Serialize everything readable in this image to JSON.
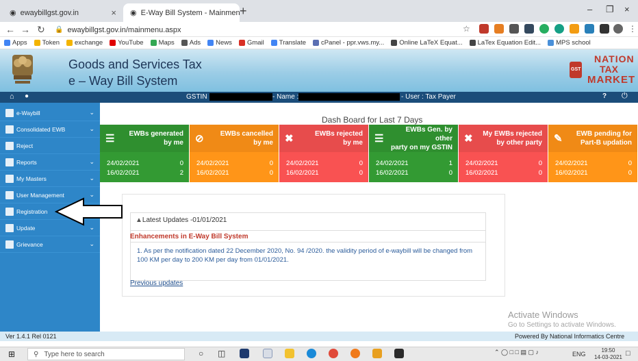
{
  "browser": {
    "tab1_title": "ewaybillgst.gov.in",
    "tab2_title": "E-Way Bill System - Mainmenu",
    "url": "ewaybillgst.gov.in/mainmenu.aspx",
    "bookmarks": [
      {
        "label": "Apps",
        "color": "#4285f4"
      },
      {
        "label": "Token",
        "color": "#f4b400"
      },
      {
        "label": "exchange",
        "color": "#f4b400"
      },
      {
        "label": "YouTube",
        "color": "#e00000"
      },
      {
        "label": "Maps",
        "color": "#34a853"
      },
      {
        "label": "Ads",
        "color": "#555555"
      },
      {
        "label": "News",
        "color": "#4285f4"
      },
      {
        "label": "Gmail",
        "color": "#d93025"
      },
      {
        "label": "Translate",
        "color": "#4285f4"
      },
      {
        "label": "cPanel - ppr.vws.my...",
        "color": "#5b6fb3"
      },
      {
        "label": "Online LaTeX Equat...",
        "color": "#444444"
      },
      {
        "label": "LaTex Equation Edit...",
        "color": "#444444"
      },
      {
        "label": "MPS school",
        "color": "#4a90d9"
      }
    ]
  },
  "header": {
    "title_line1": "Goods and Services Tax",
    "title_line2": "e – Way Bill System",
    "logo_line1": "NATION",
    "logo_line2": "TAX",
    "logo_line3": "MARKET",
    "logo_badge": "GST"
  },
  "gstbar": {
    "gstin_label": "GSTIN :",
    "name_label": "- Name :",
    "user_label": "- User : Tax Payer"
  },
  "sidebar": {
    "items": [
      {
        "label": "e-Waybill",
        "chevron": true
      },
      {
        "label": "Consolidated EWB",
        "chevron": true
      },
      {
        "label": "Reject",
        "chevron": false
      },
      {
        "label": "Reports",
        "chevron": true
      },
      {
        "label": "My Masters",
        "chevron": true
      },
      {
        "label": "User Management",
        "chevron": true
      },
      {
        "label": "Registration",
        "chevron": true
      },
      {
        "label": "Update",
        "chevron": true
      },
      {
        "label": "Grievance",
        "chevron": true
      }
    ]
  },
  "dashboard": {
    "title": "Dash Board for Last 7 Days",
    "cards": [
      {
        "title1": "EWBs generated",
        "title2": "by me",
        "icon": "☰",
        "color": "#2f8f2f",
        "rows": [
          {
            "date": "24/02/2021",
            "count": "0"
          },
          {
            "date": "16/02/2021",
            "count": "2"
          }
        ]
      },
      {
        "title1": "EWBs cancelled",
        "title2": "by me",
        "icon": "⊘",
        "color": "#f08a16",
        "rows": [
          {
            "date": "24/02/2021",
            "count": "0"
          },
          {
            "date": "16/02/2021",
            "count": "0"
          }
        ]
      },
      {
        "title1": "EWBs rejected",
        "title2": "by me",
        "icon": "✖",
        "color": "#e74c4c",
        "rows": [
          {
            "date": "24/02/2021",
            "count": "0"
          },
          {
            "date": "16/02/2021",
            "count": "0"
          }
        ]
      },
      {
        "title1": "EWBs Gen. by other",
        "title2": "party on my GSTIN",
        "icon": "☰",
        "color": "#2f8f2f",
        "rows": [
          {
            "date": "24/02/2021",
            "count": "1"
          },
          {
            "date": "16/02/2021",
            "count": "0"
          }
        ]
      },
      {
        "title1": "My EWBs rejected",
        "title2": "by other party",
        "icon": "✖",
        "color": "#e74c4c",
        "rows": [
          {
            "date": "24/02/2021",
            "count": "0"
          },
          {
            "date": "16/02/2021",
            "count": "0"
          }
        ]
      },
      {
        "title1": "EWB pending for",
        "title2": "Part-B updation",
        "icon": "✎",
        "color": "#f08a16",
        "rows": [
          {
            "date": "24/02/2021",
            "count": "0"
          },
          {
            "date": "16/02/2021",
            "count": "0"
          }
        ]
      }
    ]
  },
  "updates": {
    "heading": "Latest Updates -01/01/2021",
    "subheading": "Enhancements in E-Way Bill System",
    "item1": "1. As per the notification dated 22 December 2020, No. 94 /2020. the validity period of e-waybill will be changed from",
    "item2": "100 KM per day to 200 KM per day from 01/01/2021.",
    "previous": "Previous updates"
  },
  "footer": {
    "version": "Ver 1.4.1 Rel 0121",
    "powered": "Powered By National Informatics Centre"
  },
  "watermark": {
    "line1": "Activate Windows",
    "line2": "Go to Settings to activate Windows."
  },
  "taskbar": {
    "search_placeholder": "Type here to search",
    "lang": "ENG",
    "time": "19:50",
    "date": "14-03-2021"
  }
}
